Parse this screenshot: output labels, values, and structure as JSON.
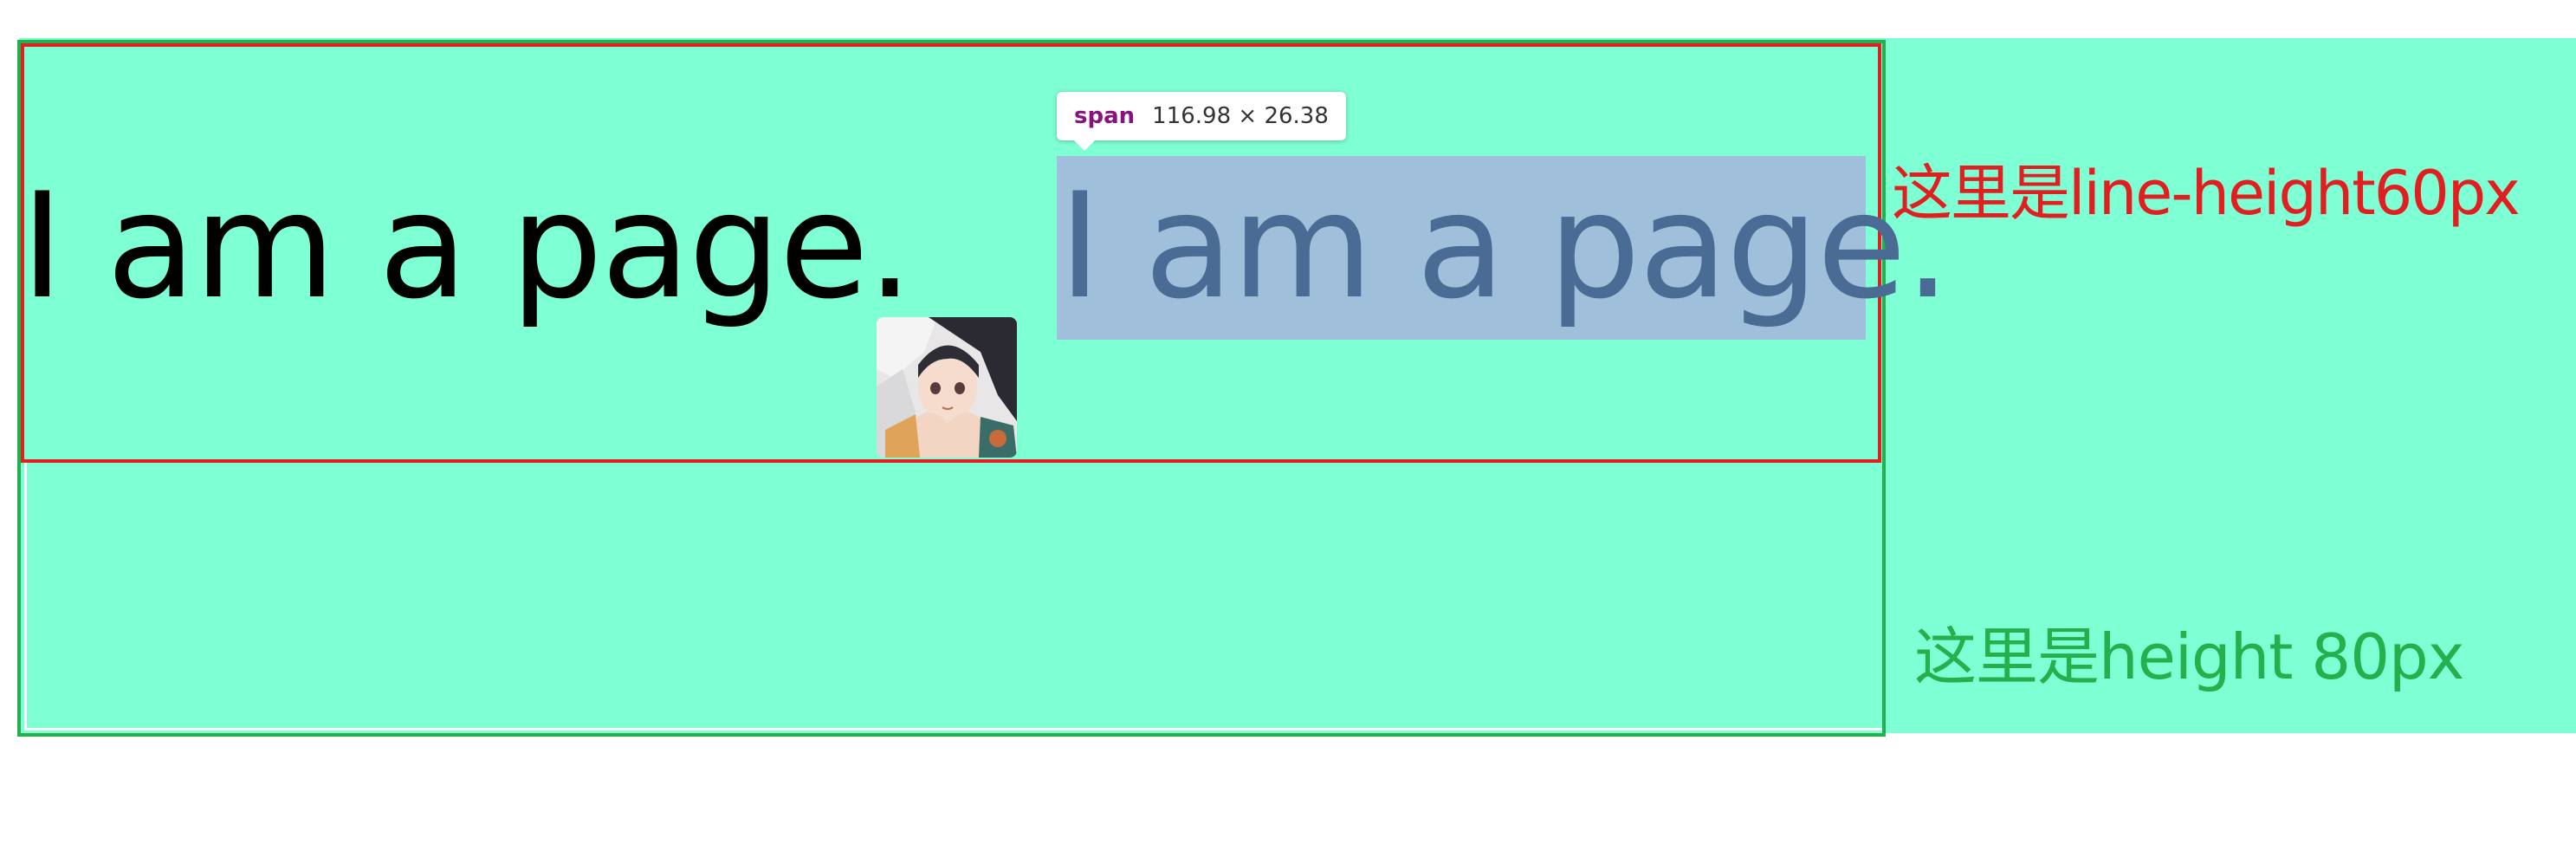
{
  "page": {
    "text_left": "I am a page.",
    "text_right": "I am a page."
  },
  "tooltip": {
    "tag": "span",
    "dimensions": "116.98 × 26.38"
  },
  "annotations": {
    "line_height_label": "这里是line-height60px",
    "height_label": "这里是height 80px"
  },
  "avatar": {
    "icon": "anime-girl-avatar"
  },
  "colors": {
    "page_background": "#7fffd4",
    "line_height_outline": "#e02020",
    "height_outline": "#22b14c",
    "span_highlight": "#9fbfdb",
    "tooltip_tag": "#881280"
  }
}
